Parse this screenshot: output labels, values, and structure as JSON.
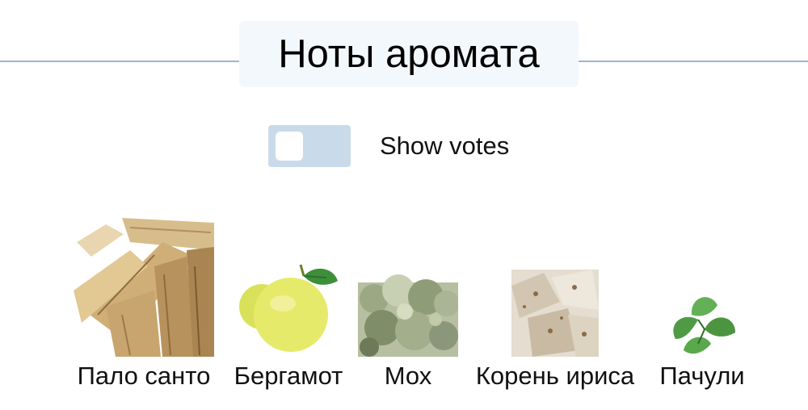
{
  "section": {
    "title": "Ноты аромата"
  },
  "votes_toggle": {
    "label": "Show votes",
    "checked": false
  },
  "notes": [
    {
      "name": "Пало санто",
      "icon": "palo-santo-wood-image"
    },
    {
      "name": "Бергамот",
      "icon": "bergamot-fruit-image"
    },
    {
      "name": "Мох",
      "icon": "moss-image"
    },
    {
      "name": "Корень ириса",
      "icon": "iris-root-image"
    },
    {
      "name": "Пачули",
      "icon": "patchouli-leaf-image"
    }
  ],
  "colors": {
    "divider": "#9fb3cc",
    "title_bg": "#f3f8fd",
    "toggle_track": "#c9dbea"
  }
}
